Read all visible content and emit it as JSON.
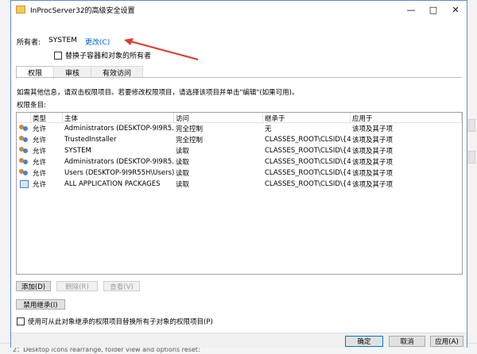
{
  "window": {
    "title": "InProcServer32的高级安全设置",
    "minimize_icon": "minimize-icon",
    "maximize_icon": "maximize-icon",
    "close_icon": "close-icon"
  },
  "owner": {
    "label": "所有者:",
    "name": "SYSTEM",
    "change_link": "更改(C)",
    "replace_checkbox_label": "替换子容器和对象的所有者"
  },
  "tabs": [
    {
      "label": "权限",
      "active": true
    },
    {
      "label": "审核",
      "active": false
    },
    {
      "label": "有效访问",
      "active": false
    }
  ],
  "info_text": "如需其他信息，请双击权限项目。若要修改权限项目，请选择该项目并单击\"编辑\"(如果可用)。",
  "entries_label": "权限条目:",
  "table": {
    "headers": [
      "类型",
      "主体",
      "访问",
      "继承于",
      "应用于"
    ],
    "rows": [
      {
        "icon": "users-icon",
        "type": "允许",
        "principal": "Administrators (DESKTOP-9I9R5...",
        "access": "完全控制",
        "inherited": "无",
        "applies": "该项及其子项"
      },
      {
        "icon": "users-icon",
        "type": "允许",
        "principal": "TrustedInstaller",
        "access": "完全控制",
        "inherited": "CLASSES_ROOT\\CLSID\\{4...",
        "applies": "该项及其子项"
      },
      {
        "icon": "users-icon",
        "type": "允许",
        "principal": "SYSTEM",
        "access": "读取",
        "inherited": "CLASSES_ROOT\\CLSID\\{4...",
        "applies": "该项及其子项"
      },
      {
        "icon": "users-icon",
        "type": "允许",
        "principal": "Administrators (DESKTOP-9I9R5...",
        "access": "读取",
        "inherited": "CLASSES_ROOT\\CLSID\\{4...",
        "applies": "该项及其子项"
      },
      {
        "icon": "users-icon",
        "type": "允许",
        "principal": "Users (DESKTOP-9I9R55H\\Users)",
        "access": "读取",
        "inherited": "CLASSES_ROOT\\CLSID\\{4...",
        "applies": "该项及其子项"
      },
      {
        "icon": "package-icon",
        "type": "允许",
        "principal": "ALL APPLICATION PACKAGES",
        "access": "读取",
        "inherited": "CLASSES_ROOT\\CLSID\\{4...",
        "applies": "该项及其子项"
      }
    ]
  },
  "buttons": {
    "add": "添加(D)",
    "remove": "删除(R)",
    "view": "查看(V)",
    "disable_inheritance": "禁用继承(I)"
  },
  "replace_child_label": "使用可从此对象继承的权限项目替换所有子对象的权限项目(P)",
  "footer": {
    "ok": "确定",
    "cancel": "取消",
    "apply": "应用(A)"
  },
  "background_text": "2：Desktop icons rearrange, folder view and options reset:",
  "colors": {
    "accent": "#0078d7",
    "link": "#0066cc",
    "annotation_arrow": "#e03a2f"
  }
}
